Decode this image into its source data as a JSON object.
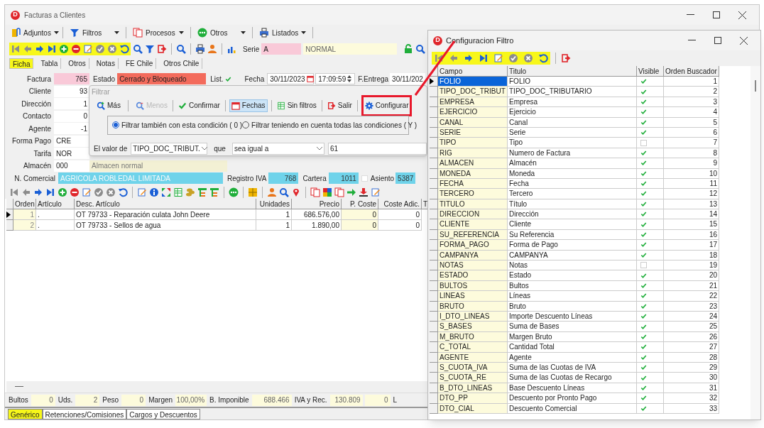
{
  "main_window": {
    "logo": "D",
    "title": "Facturas a Clientes"
  },
  "menu": [
    {
      "label": "Adjuntos"
    },
    {
      "label": "Filtros"
    },
    {
      "label": "Procesos"
    },
    {
      "label": "Otros"
    },
    {
      "label": "Listados"
    }
  ],
  "serie": {
    "label": "Serie",
    "code": "A",
    "name": "NORMAL"
  },
  "tabs": [
    {
      "label": "Ficha",
      "selected": true
    },
    {
      "label": "Tabla",
      "selected": false
    },
    {
      "label": "Otros",
      "selected": false
    },
    {
      "label": "Notas",
      "selected": false
    },
    {
      "label": "FE Chile",
      "selected": false
    },
    {
      "label": "Otros Chile",
      "selected": false
    }
  ],
  "form": {
    "factura": {
      "label": "Factura",
      "value": "765"
    },
    "estado": {
      "label": "Estado",
      "value": "Cerrado y Bloqueado"
    },
    "list": {
      "label": "List.",
      "checked": true
    },
    "fecha": {
      "label": "Fecha",
      "date": "30/11/2023",
      "time": "17:09:59"
    },
    "entrega": {
      "label": "F.Entrega",
      "value": "30/11/202"
    },
    "rows": [
      {
        "label": "Cliente",
        "value": "93"
      },
      {
        "label": "Dirección",
        "value": "1"
      },
      {
        "label": "Contacto",
        "value": "0"
      },
      {
        "label": "Agente",
        "value": "-1"
      },
      {
        "label": "Forma Pago",
        "value": "CRE"
      },
      {
        "label": "Tarifa",
        "value": "NOR"
      },
      {
        "label": "Almacén",
        "value": "000",
        "description": "Almacen normal"
      }
    ],
    "comercial": {
      "label": "N. Comercial",
      "value": "AGRICOLA ROBLEDAL LIMITADA"
    },
    "registro_iva": {
      "label": "Registro IVA",
      "value": "768"
    },
    "cartera": {
      "label": "Cartera",
      "value": "1011",
      "checked": false
    },
    "asiento": {
      "label": "Asiento",
      "value": "5387"
    }
  },
  "lines": {
    "columns": [
      "Orden",
      "Artículo",
      "Desc. Artículo",
      "Unidades",
      "Precio",
      "P. Coste",
      "Coste Adic.",
      "T"
    ],
    "rows": [
      {
        "selected": true,
        "cells": [
          "1",
          ".",
          "OT 79733 - Reparación culata John Deere",
          "1",
          "686.576,00",
          "0",
          "0"
        ]
      },
      {
        "selected": false,
        "cells": [
          "2",
          ".",
          "OT 79733 - Sellos de agua",
          "1",
          "1.890,00",
          "0",
          "0"
        ]
      }
    ]
  },
  "totals": [
    {
      "label": "Bultos",
      "value": "0"
    },
    {
      "label": "Uds.",
      "value": "2"
    },
    {
      "label": "Peso",
      "value": "0"
    },
    {
      "label": "Margen",
      "value": "100,00%"
    },
    {
      "label": "B. Imponible",
      "value": "688.466"
    },
    {
      "label": "IVA y Rec.",
      "value": "130.809"
    },
    {
      "value": "0"
    },
    {
      "label": "L"
    }
  ],
  "bottom_tabs": [
    {
      "label": "Genérico",
      "selected": true
    },
    {
      "label": "Retenciones/Comisiones",
      "selected": false
    },
    {
      "label": "Cargos y Descuentos",
      "selected": false
    }
  ],
  "filter_dialog": {
    "title": "Filtrar",
    "buttons": [
      {
        "label": "Más",
        "disabled": false,
        "selected": false
      },
      {
        "label": "Menos",
        "disabled": true,
        "selected": false
      },
      {
        "label": "Confirmar",
        "disabled": false,
        "selected": false
      },
      {
        "label": "Fechas",
        "disabled": false,
        "selected": true
      },
      {
        "label": "Sin filtros",
        "disabled": false,
        "selected": false
      },
      {
        "label": "Salir",
        "disabled": false,
        "selected": false
      },
      {
        "label": "Configurar",
        "disabled": false,
        "selected": false
      }
    ],
    "options": [
      {
        "label": "Filtrar también con esta condición ( 0 )",
        "selected": true
      },
      {
        "label": "Filtrar teniendo en cuenta todas las condiciones ( Y )",
        "selected": false
      }
    ],
    "condition": {
      "label": "El valor de",
      "field": "TIPO_DOC_TRIBUT.",
      "operator_label": "que",
      "operator": "sea igual a",
      "value": "61"
    }
  },
  "config_window": {
    "logo": "D",
    "title": "Configuracion Filtro",
    "columns": [
      "Campo",
      "Titulo",
      "Visible",
      "Orden Buscador"
    ],
    "rows": [
      {
        "campo": "FOLIO",
        "titulo": "FOLIO",
        "visible": true,
        "order": "1",
        "selected": true
      },
      {
        "campo": "TIPO_DOC_TRIBUT",
        "titulo": "TIPO_DOC_TRIBUTARIO",
        "visible": true,
        "order": "2",
        "selected": false
      },
      {
        "campo": "EMPRESA",
        "titulo": "Empresa",
        "visible": true,
        "order": "3",
        "selected": false
      },
      {
        "campo": "EJERCICIO",
        "titulo": "Ejercicio",
        "visible": true,
        "order": "4",
        "selected": false
      },
      {
        "campo": "CANAL",
        "titulo": "Canal",
        "visible": true,
        "order": "5",
        "selected": false
      },
      {
        "campo": "SERIE",
        "titulo": "Serie",
        "visible": true,
        "order": "6",
        "selected": false
      },
      {
        "campo": "TIPO",
        "titulo": "Tipo",
        "visible": false,
        "order": "7",
        "selected": false
      },
      {
        "campo": "RIG",
        "titulo": "Numero de Factura",
        "visible": true,
        "order": "8",
        "selected": false
      },
      {
        "campo": "ALMACEN",
        "titulo": "Almacén",
        "visible": true,
        "order": "9",
        "selected": false
      },
      {
        "campo": "MONEDA",
        "titulo": "Moneda",
        "visible": true,
        "order": "10",
        "selected": false
      },
      {
        "campo": "FECHA",
        "titulo": "Fecha",
        "visible": true,
        "order": "11",
        "selected": false
      },
      {
        "campo": "TERCERO",
        "titulo": "Tercero",
        "visible": true,
        "order": "12",
        "selected": false
      },
      {
        "campo": "TITULO",
        "titulo": "Título",
        "visible": true,
        "order": "13",
        "selected": false
      },
      {
        "campo": "DIRECCION",
        "titulo": "Dirección",
        "visible": true,
        "order": "14",
        "selected": false
      },
      {
        "campo": "CLIENTE",
        "titulo": "Cliente",
        "visible": true,
        "order": "15",
        "selected": false
      },
      {
        "campo": "SU_REFERENCIA",
        "titulo": "Su Referencia",
        "visible": true,
        "order": "16",
        "selected": false
      },
      {
        "campo": "FORMA_PAGO",
        "titulo": "Forma de Pago",
        "visible": true,
        "order": "17",
        "selected": false
      },
      {
        "campo": "CAMPANYA",
        "titulo": "CAMPANYA",
        "visible": true,
        "order": "18",
        "selected": false
      },
      {
        "campo": "NOTAS",
        "titulo": "Notas",
        "visible": false,
        "order": "19",
        "selected": false
      },
      {
        "campo": "ESTADO",
        "titulo": "Estado",
        "visible": true,
        "order": "20",
        "selected": false
      },
      {
        "campo": "BULTOS",
        "titulo": "Bultos",
        "visible": true,
        "order": "21",
        "selected": false
      },
      {
        "campo": "LINEAS",
        "titulo": "Líneas",
        "visible": true,
        "order": "22",
        "selected": false
      },
      {
        "campo": "BRUTO",
        "titulo": "Bruto",
        "visible": true,
        "order": "23",
        "selected": false
      },
      {
        "campo": "I_DTO_LINEAS",
        "titulo": "Importe Descuento Líneas",
        "visible": true,
        "order": "24",
        "selected": false
      },
      {
        "campo": "S_BASES",
        "titulo": "Suma de Bases",
        "visible": true,
        "order": "25",
        "selected": false
      },
      {
        "campo": "M_BRUTO",
        "titulo": "Margen Bruto",
        "visible": true,
        "order": "26",
        "selected": false
      },
      {
        "campo": "C_TOTAL",
        "titulo": "Cantidad Total",
        "visible": true,
        "order": "27",
        "selected": false
      },
      {
        "campo": "AGENTE",
        "titulo": "Agente",
        "visible": true,
        "order": "28",
        "selected": false
      },
      {
        "campo": "S_CUOTA_IVA",
        "titulo": "Suma de las Cuotas de IVA",
        "visible": true,
        "order": "29",
        "selected": false
      },
      {
        "campo": "S_CUOTA_RE",
        "titulo": "Suma de las Cuotas de Recargo",
        "visible": true,
        "order": "30",
        "selected": false
      },
      {
        "campo": "B_DTO_LINEAS",
        "titulo": "Base Descuento Líneas",
        "visible": true,
        "order": "31",
        "selected": false
      },
      {
        "campo": "DTO_PP",
        "titulo": "Descuento por Pronto Pago",
        "visible": true,
        "order": "32",
        "selected": false
      },
      {
        "campo": "DTO_CIAL",
        "titulo": "Descuento Comercial",
        "visible": true,
        "order": "33",
        "selected": false
      }
    ]
  }
}
